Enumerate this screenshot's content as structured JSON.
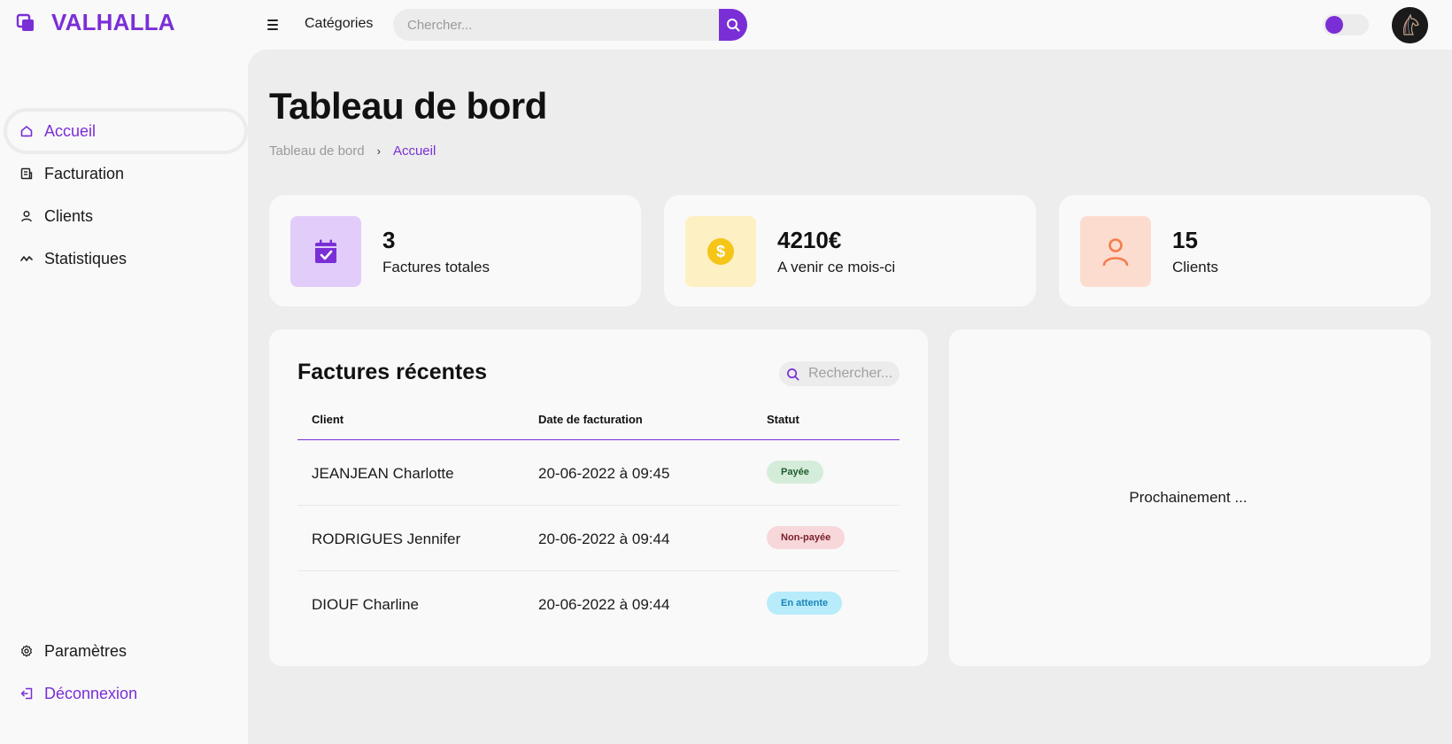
{
  "brand": {
    "name": "VALHALLA",
    "color": "#7a2fd6"
  },
  "topbar": {
    "categories_label": "Catégories",
    "search_placeholder": "Chercher...",
    "theme_toggle": "on"
  },
  "sidebar": {
    "items": [
      {
        "label": "Accueil",
        "icon": "home-icon",
        "active": true
      },
      {
        "label": "Facturation",
        "icon": "invoice-icon"
      },
      {
        "label": "Clients",
        "icon": "user-icon"
      },
      {
        "label": "Statistiques",
        "icon": "trend-icon"
      }
    ],
    "bottom": [
      {
        "label": "Paramètres",
        "icon": "gear-icon"
      },
      {
        "label": "Déconnexion",
        "icon": "logout-icon"
      }
    ]
  },
  "page": {
    "title": "Tableau de bord",
    "breadcrumb": {
      "parent": "Tableau de bord",
      "current": "Accueil"
    }
  },
  "stats": [
    {
      "value": "3",
      "label": "Factures totales",
      "icon": "calendar-check-icon",
      "bg": "#e2ccf9",
      "fg": "#7a2fd6"
    },
    {
      "value": "4210€",
      "label": "A venir ce mois-ci",
      "icon": "dollar-coin-icon",
      "bg": "#fdf0c2",
      "fg": "#f5c518"
    },
    {
      "value": "15",
      "label": "Clients",
      "icon": "user-icon",
      "bg": "#fddcd0",
      "fg": "#f47c4c"
    }
  ],
  "recent_invoices": {
    "title": "Factures récentes",
    "search_placeholder": "Rechercher...",
    "columns": [
      "Client",
      "Date de facturation",
      "Statut"
    ],
    "rows": [
      {
        "client": "JEANJEAN Charlotte",
        "date": "20-06-2022 à 09:45",
        "status": "Payée",
        "status_bg": "#d4edda",
        "status_fg": "#1e5b2e"
      },
      {
        "client": "RODRIGUES Jennifer",
        "date": "20-06-2022 à 09:44",
        "status": "Non-payée",
        "status_bg": "#f8d7da",
        "status_fg": "#7a1f28"
      },
      {
        "client": "DIOUF Charline",
        "date": "20-06-2022 à 09:44",
        "status": "En attente",
        "status_bg": "#b8ecfb",
        "status_fg": "#1a86b8"
      }
    ]
  },
  "side_panel": {
    "text": "Prochainement ..."
  }
}
